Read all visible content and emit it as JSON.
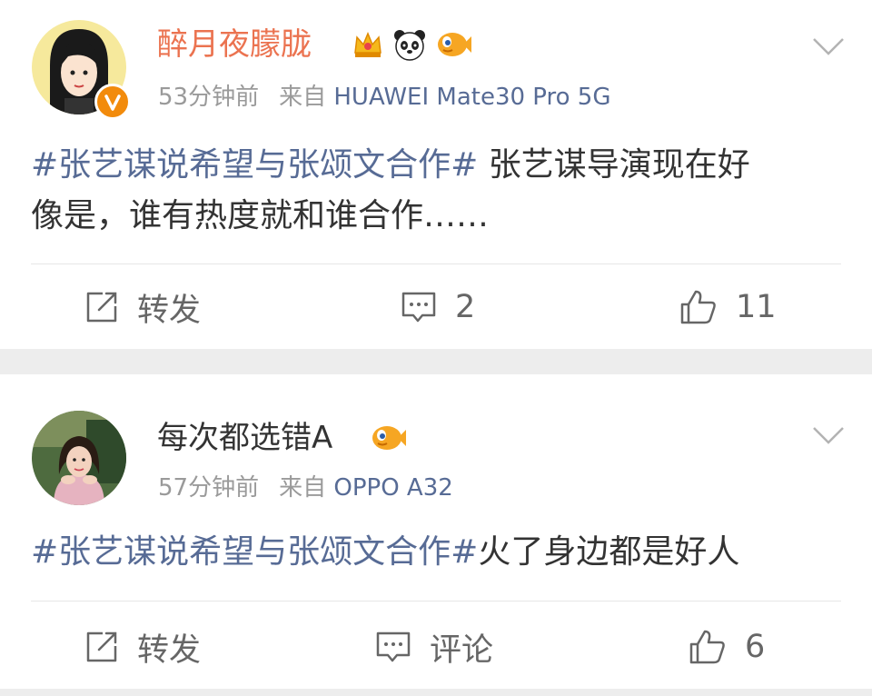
{
  "posts": [
    {
      "author": "醉月夜朦胧",
      "time": "53分钟前",
      "from_label": "来自",
      "source": "HUAWEI Mate30 Pro 5G",
      "badges": [
        "crown-badge-icon",
        "panda-badge-icon",
        "fish-badge-icon"
      ],
      "verified": true,
      "topic": "#张艺谋说希望与张颂文合作#",
      "text_line1": " 张艺谋导演现在好",
      "text_line2": "像是，谁有热度就和谁合作……",
      "actions": {
        "repost": "转发",
        "comments": "2",
        "likes": "11"
      }
    },
    {
      "author": "每次都选错A",
      "time": "57分钟前",
      "from_label": "来自",
      "source": "OPPO A32",
      "badges": [
        "fish-badge-icon"
      ],
      "verified": false,
      "topic": "#张艺谋说希望与张颂文合作#",
      "text": "火了身边都是好人",
      "actions": {
        "repost": "转发",
        "comments": "评论",
        "likes": "6"
      }
    }
  ],
  "colors": {
    "vip_name": "#eb7350",
    "link": "#576b95",
    "meta": "#9a9a9a",
    "text": "#333333"
  }
}
